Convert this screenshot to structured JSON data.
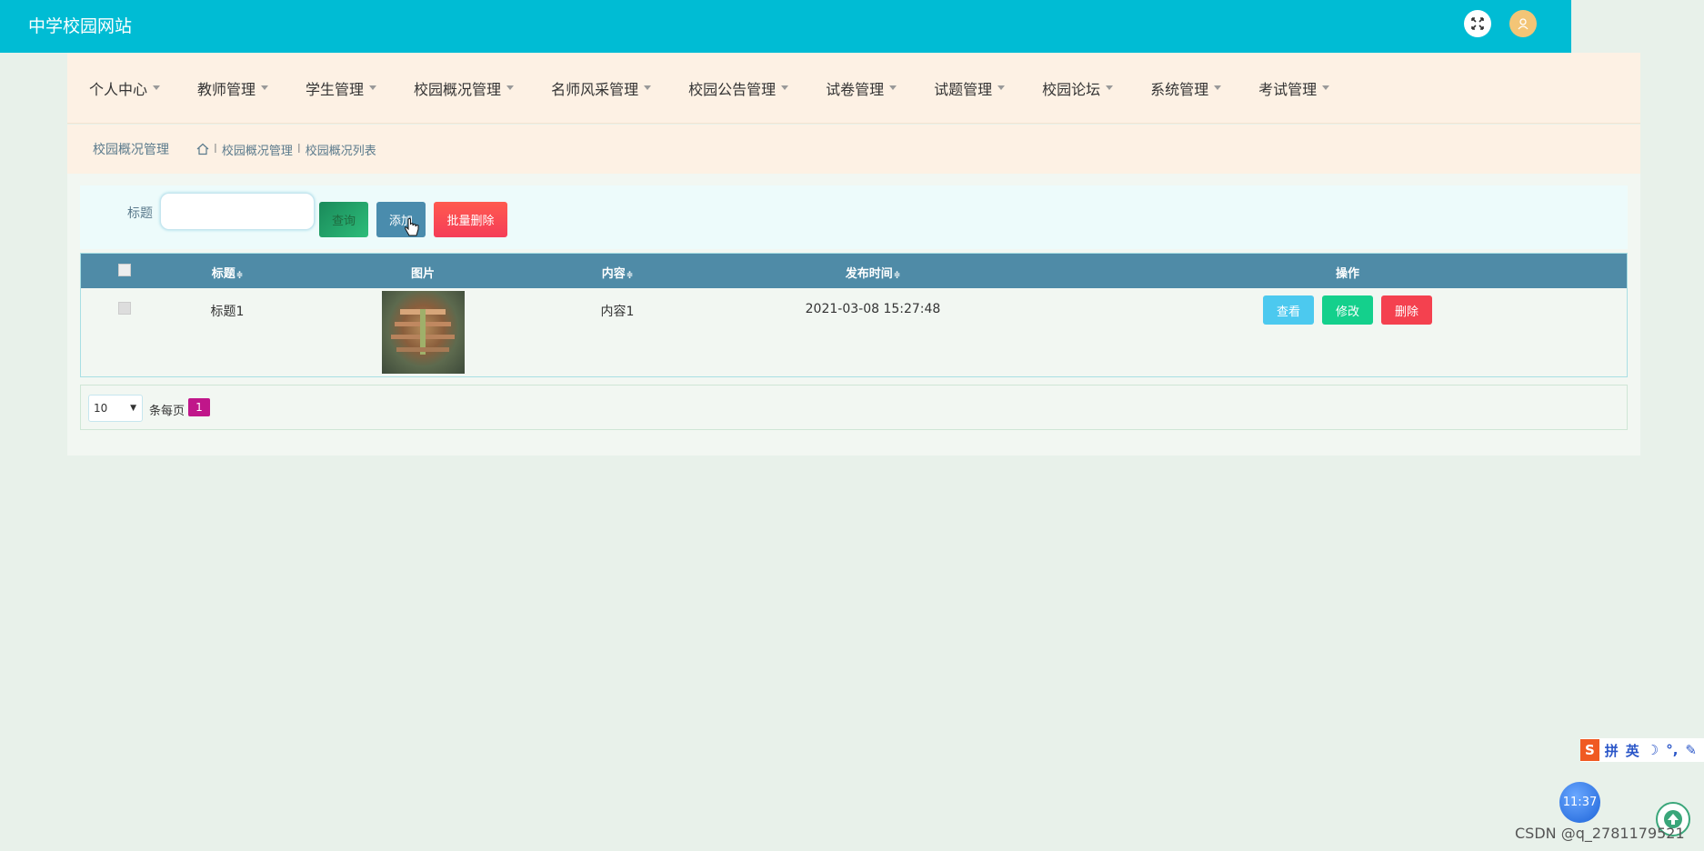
{
  "header": {
    "site_title": "中学校园网站",
    "fullscreen_icon": "fullscreen-icon",
    "avatar_icon": "user-icon"
  },
  "nav": {
    "items": [
      {
        "label": "个人中心"
      },
      {
        "label": "教师管理"
      },
      {
        "label": "学生管理"
      },
      {
        "label": "校园概况管理"
      },
      {
        "label": "名师风采管理"
      },
      {
        "label": "校园公告管理"
      },
      {
        "label": "试卷管理"
      },
      {
        "label": "试题管理"
      },
      {
        "label": "校园论坛"
      },
      {
        "label": "系统管理"
      },
      {
        "label": "考试管理"
      }
    ]
  },
  "breadcrumb": {
    "title": "校园概况管理",
    "separator": "I",
    "path": [
      "校园概况管理",
      "校园概况列表"
    ]
  },
  "search": {
    "label": "标题",
    "value": "",
    "search_button": "查询",
    "add_button": "添加",
    "batch_delete_button": "批量删除"
  },
  "table": {
    "headers": {
      "title": "标题",
      "image": "图片",
      "content": "内容",
      "publish_time": "发布时间",
      "actions": "操作"
    },
    "sort_glyph": "≑",
    "rows": [
      {
        "title": "标题1",
        "content": "内容1",
        "publish_time": "2021-03-08 15:27:48",
        "view": "查看",
        "edit": "修改",
        "delete": "删除"
      }
    ]
  },
  "pagination": {
    "page_size": "10",
    "per_page_label": "条每页",
    "current_page": "1"
  },
  "taskbar": {
    "ime_items": [
      "拼",
      "英"
    ],
    "clock": "11:37"
  },
  "watermark": "CSDN @q_2781179521",
  "colors": {
    "topbar": "#00bcd4",
    "nav_bg": "#fdf1e4",
    "table_header": "#4f8ba7",
    "view_btn": "#4cc9ef",
    "edit_btn": "#14d08c",
    "delete_btn": "#f4414f",
    "page_active": "#c0168a"
  }
}
